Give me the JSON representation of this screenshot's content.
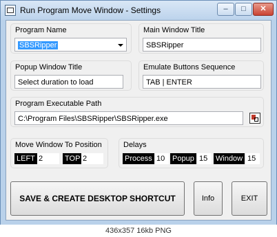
{
  "window": {
    "title": "Run Program Move Window - Settings",
    "controls": {
      "minimize": "–",
      "maximize": "□",
      "close": "✕"
    }
  },
  "program_name": {
    "label": "Program Name",
    "value": "SBSRipper"
  },
  "main_window_title": {
    "label": "Main Window Title",
    "value": "SBSRipper"
  },
  "popup_window_title": {
    "label": "Popup Window Title",
    "value": "Select duration to load"
  },
  "emulate_buttons": {
    "label": "Emulate Buttons Sequence",
    "value": "TAB | ENTER"
  },
  "executable_path": {
    "label": "Program Executable Path",
    "value": "C:\\Program Files\\SBSRipper\\SBSRipper.exe"
  },
  "move_window": {
    "label": "Move Window To Position",
    "left_label": "LEFT",
    "left_value": "2",
    "top_label": "TOP",
    "top_value": "2"
  },
  "delays": {
    "label": "Delays",
    "process_label": "Process",
    "process_value": "10",
    "popup_label": "Popup",
    "popup_value": "15",
    "window_label": "Window",
    "window_value": "15"
  },
  "buttons": {
    "save": "SAVE & CREATE DESKTOP SHORTCUT",
    "info": "Info",
    "exit": "EXIT"
  },
  "caption": "436x357  16kb  PNG"
}
